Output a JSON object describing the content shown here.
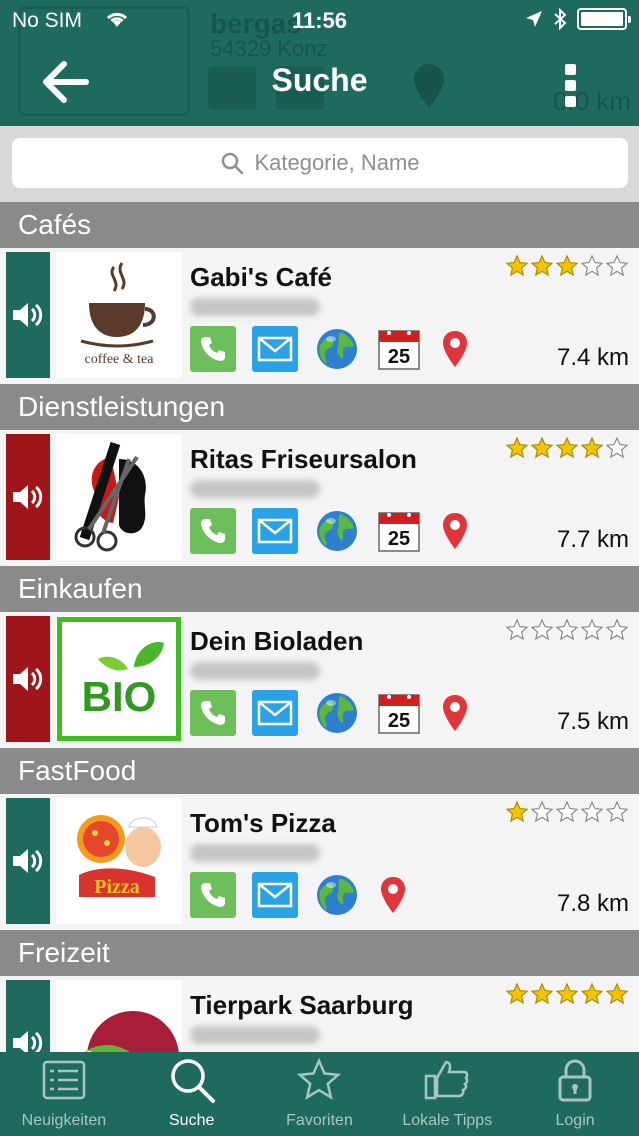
{
  "status_bar": {
    "carrier": "No SIM",
    "time": "11:56"
  },
  "header": {
    "title": "Suche",
    "background_card": {
      "name": "bergas",
      "city": "54329 Konz",
      "distance": "0.0 km",
      "logo_text": "berga"
    }
  },
  "search": {
    "placeholder": "Kategorie, Name"
  },
  "sections": [
    {
      "header": "Cafés",
      "item": {
        "name": "Gabi's Café",
        "distance": "7.4 km",
        "rating": 3,
        "sound_color": "#1e6b5e",
        "has_calendar": true,
        "calendar_day": "25",
        "logo": "coffee-tea-logo",
        "logo_caption": "coffee & tea"
      }
    },
    {
      "header": "Dienstleistungen",
      "item": {
        "name": "Ritas Friseursalon",
        "distance": "7.7 km",
        "rating": 4,
        "sound_color": "#a0151a",
        "has_calendar": true,
        "calendar_day": "25",
        "logo": "hair-salon-logo"
      }
    },
    {
      "header": "Einkaufen",
      "item": {
        "name": "Dein Bioladen",
        "distance": "7.5 km",
        "rating": 0,
        "sound_color": "#a0151a",
        "has_calendar": true,
        "calendar_day": "25",
        "logo": "bio-logo",
        "logo_caption": "BIO"
      }
    },
    {
      "header": "FastFood",
      "item": {
        "name": "Tom's Pizza",
        "distance": "7.8 km",
        "rating": 1,
        "sound_color": "#1e6b5e",
        "has_calendar": false,
        "logo": "pizza-logo"
      }
    },
    {
      "header": "Freizeit",
      "item": {
        "name": "Tierpark Saarburg",
        "distance": "",
        "rating": 5,
        "sound_color": "#1e6b5e",
        "has_calendar": false,
        "logo": "chameleon-logo"
      }
    }
  ],
  "tabs": [
    {
      "label": "Neuigkeiten",
      "icon": "list-icon",
      "active": false
    },
    {
      "label": "Suche",
      "icon": "search-icon",
      "active": true
    },
    {
      "label": "Favoriten",
      "icon": "star-icon",
      "active": false
    },
    {
      "label": "Lokale Tipps",
      "icon": "thumbs-up-icon",
      "active": false
    },
    {
      "label": "Login",
      "icon": "lock-icon",
      "active": false
    }
  ],
  "colors": {
    "primary": "#1e6b5e",
    "sound_red": "#a0151a",
    "section_gray": "#8a8a8a",
    "star": "#f2c500"
  }
}
